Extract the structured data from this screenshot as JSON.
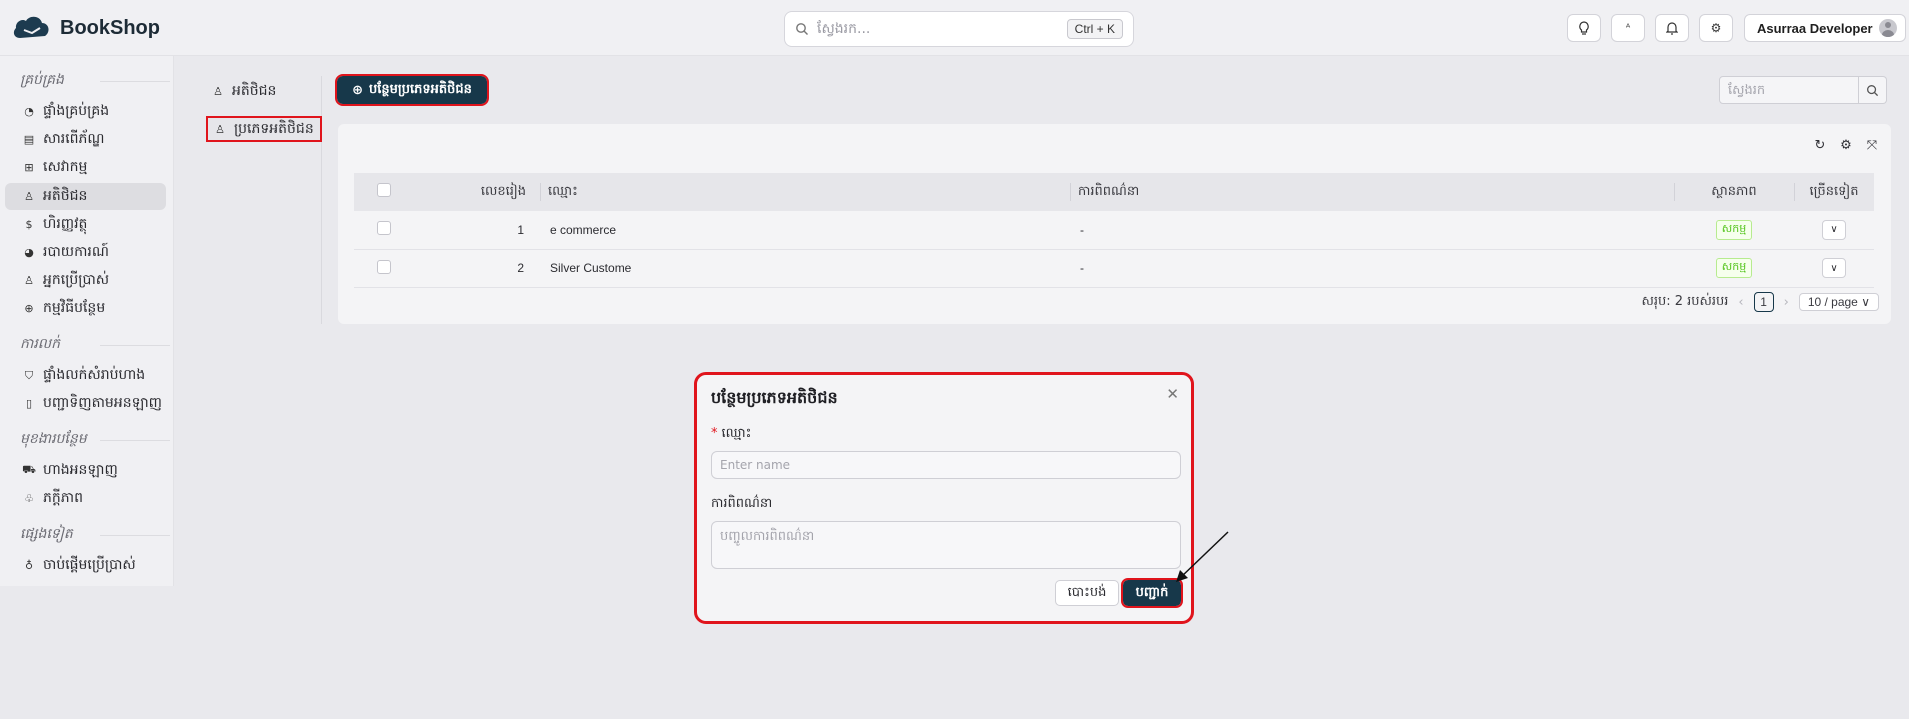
{
  "header": {
    "app_name": "BookShop",
    "search_placeholder": "ស្វែងរក...",
    "search_shortcut": "Ctrl + K",
    "user_name": "Asurraa Developer",
    "icon_buttons": [
      "bulb-icon",
      "translate-icon",
      "bell-icon",
      "gear-icon"
    ]
  },
  "sidebar": {
    "sections": [
      {
        "title": "គ្រប់គ្រង",
        "items": [
          {
            "label": "ផ្ទាំងគ្រប់គ្រង",
            "icon": "dashboard-icon"
          },
          {
            "label": "សារពើភ័ណ្ឌ",
            "icon": "inventory-icon"
          },
          {
            "label": "សេវាកម្ម",
            "icon": "grid-icon"
          },
          {
            "label": "អតិថិជន",
            "icon": "user-icon",
            "active": true
          },
          {
            "label": "ហិរញ្ញវត្ថុ",
            "icon": "dollar-icon"
          },
          {
            "label": "របាយការណ៍",
            "icon": "pie-chart-icon"
          },
          {
            "label": "អ្នកប្រើប្រាស់",
            "icon": "users-icon"
          },
          {
            "label": "កម្មវិធីបន្ថែម",
            "icon": "plus-circle-icon"
          }
        ]
      },
      {
        "title": "ការលក់",
        "items": [
          {
            "label": "ផ្ទាំងលក់សំរាប់ហាង",
            "icon": "shirt-icon"
          },
          {
            "label": "បញ្ជាទិញតាមអនឡាញ",
            "icon": "clipboard-icon"
          }
        ]
      },
      {
        "title": "មុខងារបន្ថែម",
        "items": [
          {
            "label": "ហាងអនឡាញ",
            "icon": "cart-icon"
          },
          {
            "label": "ភក្ដីភាព",
            "icon": "loyalty-icon"
          }
        ]
      },
      {
        "title": "ផ្សេងទៀត",
        "items": [
          {
            "label": "ចាប់ផ្តើមប្រើប្រាស់",
            "icon": "bulb-icon"
          }
        ]
      }
    ]
  },
  "subnav": {
    "items": [
      {
        "label": "អតិថិជន",
        "icon": "user-icon"
      },
      {
        "label": "ប្រភេទអតិថិជន",
        "icon": "user-group-icon",
        "highlighted": true
      }
    ]
  },
  "main": {
    "add_button_label": "បន្ថែមប្រភេទអតិថិជន",
    "search_placeholder": "ស្វែងរក",
    "table": {
      "columns": [
        "លេខរៀង",
        "ឈ្មោះ",
        "ការពិពណ៌នា",
        "ស្ថានភាព",
        "ច្រើនទៀត"
      ],
      "rows": [
        {
          "no": "1",
          "name": "e commerce",
          "description": "-",
          "status": "សកម្ម"
        },
        {
          "no": "2",
          "name": "Silver Custome",
          "description": "-",
          "status": "សកម្ម"
        }
      ]
    },
    "pagination": {
      "total_text": "សរុប: 2 របស់របរ",
      "current_page": "1",
      "page_size": "10 / page"
    }
  },
  "modal": {
    "title": "បន្ថែមប្រភេទអតិថិជន",
    "name_label": "ឈ្មោះ",
    "name_placeholder": "Enter name",
    "description_label": "ការពិពណ៌នា",
    "description_placeholder": "បញ្ចូលការពិពណ៌នា",
    "cancel_label": "បោះបង់",
    "submit_label": "បញ្ជាក់"
  },
  "colors": {
    "brand": "#17384a",
    "highlight": "#e0141c",
    "status_active": "#52c41a"
  }
}
